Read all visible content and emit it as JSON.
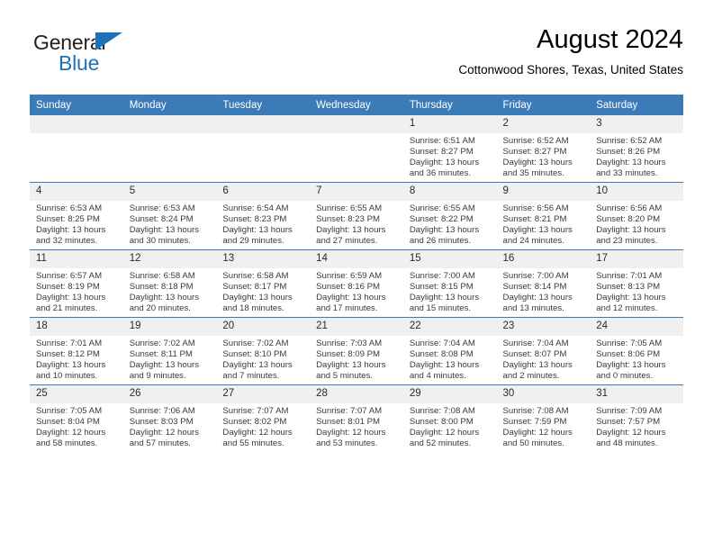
{
  "logo": {
    "word_one": "General",
    "word_two": "Blue",
    "triangle_color": "#1b72b8",
    "text_color": "#231f20"
  },
  "header": {
    "title": "August 2024",
    "subtitle": "Cottonwood Shores, Texas, United States",
    "accent_color": "#3b7cb8"
  },
  "calendar": {
    "weekday_headers": [
      "Sunday",
      "Monday",
      "Tuesday",
      "Wednesday",
      "Thursday",
      "Friday",
      "Saturday"
    ],
    "labels": {
      "sunrise": "Sunrise:",
      "sunset": "Sunset:",
      "daylight": "Daylight:"
    },
    "weeks": [
      [
        {
          "day": "",
          "sunrise": "",
          "sunset": "",
          "daylight_1": "",
          "daylight_2": ""
        },
        {
          "day": "",
          "sunrise": "",
          "sunset": "",
          "daylight_1": "",
          "daylight_2": ""
        },
        {
          "day": "",
          "sunrise": "",
          "sunset": "",
          "daylight_1": "",
          "daylight_2": ""
        },
        {
          "day": "",
          "sunrise": "",
          "sunset": "",
          "daylight_1": "",
          "daylight_2": ""
        },
        {
          "day": "1",
          "sunrise": "Sunrise: 6:51 AM",
          "sunset": "Sunset: 8:27 PM",
          "daylight_1": "Daylight: 13 hours",
          "daylight_2": "and 36 minutes."
        },
        {
          "day": "2",
          "sunrise": "Sunrise: 6:52 AM",
          "sunset": "Sunset: 8:27 PM",
          "daylight_1": "Daylight: 13 hours",
          "daylight_2": "and 35 minutes."
        },
        {
          "day": "3",
          "sunrise": "Sunrise: 6:52 AM",
          "sunset": "Sunset: 8:26 PM",
          "daylight_1": "Daylight: 13 hours",
          "daylight_2": "and 33 minutes."
        }
      ],
      [
        {
          "day": "4",
          "sunrise": "Sunrise: 6:53 AM",
          "sunset": "Sunset: 8:25 PM",
          "daylight_1": "Daylight: 13 hours",
          "daylight_2": "and 32 minutes."
        },
        {
          "day": "5",
          "sunrise": "Sunrise: 6:53 AM",
          "sunset": "Sunset: 8:24 PM",
          "daylight_1": "Daylight: 13 hours",
          "daylight_2": "and 30 minutes."
        },
        {
          "day": "6",
          "sunrise": "Sunrise: 6:54 AM",
          "sunset": "Sunset: 8:23 PM",
          "daylight_1": "Daylight: 13 hours",
          "daylight_2": "and 29 minutes."
        },
        {
          "day": "7",
          "sunrise": "Sunrise: 6:55 AM",
          "sunset": "Sunset: 8:23 PM",
          "daylight_1": "Daylight: 13 hours",
          "daylight_2": "and 27 minutes."
        },
        {
          "day": "8",
          "sunrise": "Sunrise: 6:55 AM",
          "sunset": "Sunset: 8:22 PM",
          "daylight_1": "Daylight: 13 hours",
          "daylight_2": "and 26 minutes."
        },
        {
          "day": "9",
          "sunrise": "Sunrise: 6:56 AM",
          "sunset": "Sunset: 8:21 PM",
          "daylight_1": "Daylight: 13 hours",
          "daylight_2": "and 24 minutes."
        },
        {
          "day": "10",
          "sunrise": "Sunrise: 6:56 AM",
          "sunset": "Sunset: 8:20 PM",
          "daylight_1": "Daylight: 13 hours",
          "daylight_2": "and 23 minutes."
        }
      ],
      [
        {
          "day": "11",
          "sunrise": "Sunrise: 6:57 AM",
          "sunset": "Sunset: 8:19 PM",
          "daylight_1": "Daylight: 13 hours",
          "daylight_2": "and 21 minutes."
        },
        {
          "day": "12",
          "sunrise": "Sunrise: 6:58 AM",
          "sunset": "Sunset: 8:18 PM",
          "daylight_1": "Daylight: 13 hours",
          "daylight_2": "and 20 minutes."
        },
        {
          "day": "13",
          "sunrise": "Sunrise: 6:58 AM",
          "sunset": "Sunset: 8:17 PM",
          "daylight_1": "Daylight: 13 hours",
          "daylight_2": "and 18 minutes."
        },
        {
          "day": "14",
          "sunrise": "Sunrise: 6:59 AM",
          "sunset": "Sunset: 8:16 PM",
          "daylight_1": "Daylight: 13 hours",
          "daylight_2": "and 17 minutes."
        },
        {
          "day": "15",
          "sunrise": "Sunrise: 7:00 AM",
          "sunset": "Sunset: 8:15 PM",
          "daylight_1": "Daylight: 13 hours",
          "daylight_2": "and 15 minutes."
        },
        {
          "day": "16",
          "sunrise": "Sunrise: 7:00 AM",
          "sunset": "Sunset: 8:14 PM",
          "daylight_1": "Daylight: 13 hours",
          "daylight_2": "and 13 minutes."
        },
        {
          "day": "17",
          "sunrise": "Sunrise: 7:01 AM",
          "sunset": "Sunset: 8:13 PM",
          "daylight_1": "Daylight: 13 hours",
          "daylight_2": "and 12 minutes."
        }
      ],
      [
        {
          "day": "18",
          "sunrise": "Sunrise: 7:01 AM",
          "sunset": "Sunset: 8:12 PM",
          "daylight_1": "Daylight: 13 hours",
          "daylight_2": "and 10 minutes."
        },
        {
          "day": "19",
          "sunrise": "Sunrise: 7:02 AM",
          "sunset": "Sunset: 8:11 PM",
          "daylight_1": "Daylight: 13 hours",
          "daylight_2": "and 9 minutes."
        },
        {
          "day": "20",
          "sunrise": "Sunrise: 7:02 AM",
          "sunset": "Sunset: 8:10 PM",
          "daylight_1": "Daylight: 13 hours",
          "daylight_2": "and 7 minutes."
        },
        {
          "day": "21",
          "sunrise": "Sunrise: 7:03 AM",
          "sunset": "Sunset: 8:09 PM",
          "daylight_1": "Daylight: 13 hours",
          "daylight_2": "and 5 minutes."
        },
        {
          "day": "22",
          "sunrise": "Sunrise: 7:04 AM",
          "sunset": "Sunset: 8:08 PM",
          "daylight_1": "Daylight: 13 hours",
          "daylight_2": "and 4 minutes."
        },
        {
          "day": "23",
          "sunrise": "Sunrise: 7:04 AM",
          "sunset": "Sunset: 8:07 PM",
          "daylight_1": "Daylight: 13 hours",
          "daylight_2": "and 2 minutes."
        },
        {
          "day": "24",
          "sunrise": "Sunrise: 7:05 AM",
          "sunset": "Sunset: 8:06 PM",
          "daylight_1": "Daylight: 13 hours",
          "daylight_2": "and 0 minutes."
        }
      ],
      [
        {
          "day": "25",
          "sunrise": "Sunrise: 7:05 AM",
          "sunset": "Sunset: 8:04 PM",
          "daylight_1": "Daylight: 12 hours",
          "daylight_2": "and 58 minutes."
        },
        {
          "day": "26",
          "sunrise": "Sunrise: 7:06 AM",
          "sunset": "Sunset: 8:03 PM",
          "daylight_1": "Daylight: 12 hours",
          "daylight_2": "and 57 minutes."
        },
        {
          "day": "27",
          "sunrise": "Sunrise: 7:07 AM",
          "sunset": "Sunset: 8:02 PM",
          "daylight_1": "Daylight: 12 hours",
          "daylight_2": "and 55 minutes."
        },
        {
          "day": "28",
          "sunrise": "Sunrise: 7:07 AM",
          "sunset": "Sunset: 8:01 PM",
          "daylight_1": "Daylight: 12 hours",
          "daylight_2": "and 53 minutes."
        },
        {
          "day": "29",
          "sunrise": "Sunrise: 7:08 AM",
          "sunset": "Sunset: 8:00 PM",
          "daylight_1": "Daylight: 12 hours",
          "daylight_2": "and 52 minutes."
        },
        {
          "day": "30",
          "sunrise": "Sunrise: 7:08 AM",
          "sunset": "Sunset: 7:59 PM",
          "daylight_1": "Daylight: 12 hours",
          "daylight_2": "and 50 minutes."
        },
        {
          "day": "31",
          "sunrise": "Sunrise: 7:09 AM",
          "sunset": "Sunset: 7:57 PM",
          "daylight_1": "Daylight: 12 hours",
          "daylight_2": "and 48 minutes."
        }
      ]
    ]
  }
}
